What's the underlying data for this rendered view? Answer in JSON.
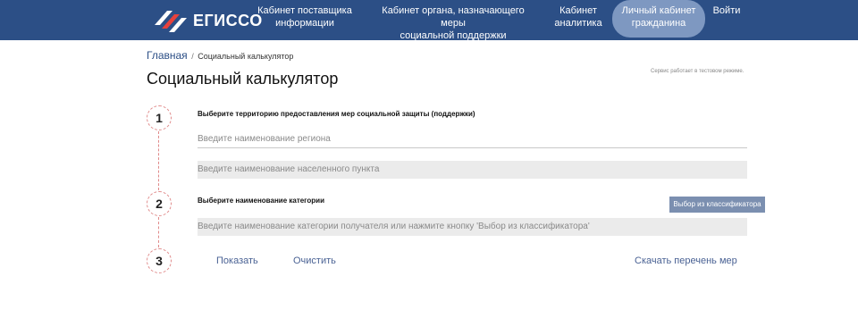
{
  "header": {
    "logo_text": "ЕГИССО",
    "nav": {
      "supplier_line1": "Кабинет поставщика",
      "supplier_line2": "информации",
      "org_line1": "Кабинет органа, назначающего меры",
      "org_line2": "социальной поддержки",
      "analyst_line1": "Кабинет",
      "analyst_line2": "аналитика",
      "citizen_line1": "Личный кабинет",
      "citizen_line2": "гражданина",
      "login": "Войти"
    },
    "colors": {
      "background": "#2c4f86",
      "active_pill": "#7e98c1"
    }
  },
  "breadcrumb": {
    "home": "Главная",
    "separator": "/",
    "current": "Социальный калькулятор"
  },
  "page": {
    "title": "Социальный калькулятор",
    "test_mode_notice": "Сервис работает в тестовом режиме."
  },
  "steps": {
    "one": {
      "number": "1",
      "label": "Выберите территорию предоставления мер социальной защиты (поддержки)",
      "region_placeholder": "Введите наименование региона",
      "locality_placeholder": "Введите наименование населенного пункта"
    },
    "two": {
      "number": "2",
      "label": "Выберите наименование категории",
      "classifier_button": "Выбор из классификатора",
      "category_placeholder": "Введите наименование категории получателя или нажмите кнопку 'Выбор из классификатора'"
    },
    "three": {
      "number": "3",
      "show": "Показать",
      "clear": "Очистить",
      "download": "Скачать перечень мер"
    }
  }
}
